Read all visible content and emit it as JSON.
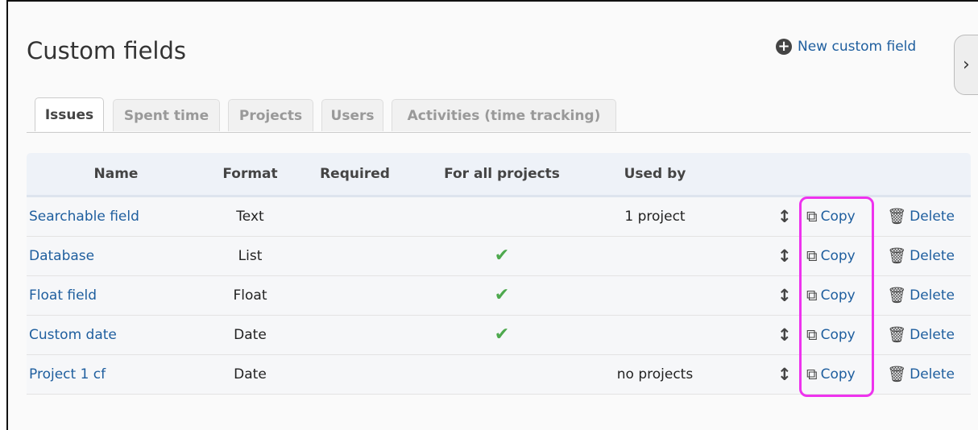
{
  "header": {
    "title": "Custom fields",
    "new_label": "New custom field",
    "plus_icon": "+",
    "toggle_icon": "›"
  },
  "tabs": [
    {
      "label": "Issues",
      "selected": true
    },
    {
      "label": "Spent time",
      "selected": false
    },
    {
      "label": "Projects",
      "selected": false
    },
    {
      "label": "Users",
      "selected": false
    },
    {
      "label": "Activities (time tracking)",
      "selected": false
    }
  ],
  "table": {
    "headers": {
      "name": "Name",
      "format": "Format",
      "required": "Required",
      "for_all": "For all projects",
      "used_by": "Used by"
    },
    "rows": [
      {
        "name": "Searchable field",
        "format": "Text",
        "for_all_mark": "",
        "used_by": "1 project"
      },
      {
        "name": "Database",
        "format": "List",
        "for_all_mark": "✔",
        "used_by": ""
      },
      {
        "name": "Float field",
        "format": "Float",
        "for_all_mark": "✔",
        "used_by": ""
      },
      {
        "name": "Custom date",
        "format": "Date",
        "for_all_mark": "✔",
        "used_by": ""
      },
      {
        "name": "Project 1 cf",
        "format": "Date",
        "for_all_mark": "",
        "used_by": "no projects"
      }
    ],
    "actions": {
      "sort_icon": "↕",
      "copy_icon": "⧉",
      "copy_label": "Copy",
      "delete_icon": "🗑",
      "delete_label": "Delete"
    }
  },
  "colors": {
    "link": "#1e5e9e",
    "check": "#4ea94e",
    "highlight": "#ee33ee"
  }
}
